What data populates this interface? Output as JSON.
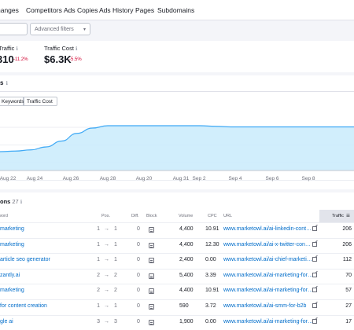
{
  "tabs": [
    "hanges",
    "Competitors",
    "Ads Copies",
    "Ads History",
    "Pages",
    "Subdomains"
  ],
  "filters": {
    "advanced_label": "Advanced filters"
  },
  "metrics": [
    {
      "label": "Traffic",
      "value": "310",
      "delta": "-11.2%"
    },
    {
      "label": "Traffic Cost",
      "value": "$6.3K",
      "delta": "-5.5%"
    }
  ],
  "chart_card": {
    "title": "s",
    "toggle_1": "Keywords",
    "toggle_2": "Traffic Cost"
  },
  "chart_data": {
    "type": "area",
    "x_tick_labels": [
      "Aug 22",
      "Aug 24",
      "Aug 26",
      "Aug 28",
      "Aug 20",
      "Aug 31",
      "Sep 2",
      "Sep 4",
      "Sep 6",
      "Sep 8"
    ],
    "series": [
      {
        "values": [
          0.32,
          0.33,
          0.35,
          0.4,
          0.5,
          0.63,
          0.72,
          0.76,
          0.76,
          0.76,
          0.76,
          0.76,
          0.76,
          0.76,
          0.75,
          0.74,
          0.74,
          0.74,
          0.74,
          0.74,
          0.74,
          0.74,
          0.74,
          0.74
        ]
      }
    ],
    "ylim": [
      0,
      1
    ],
    "grid": true,
    "colors": {
      "line": "#3fa9f5",
      "fill": "#c9ebfb"
    }
  },
  "table": {
    "title": "ons",
    "count": "27",
    "headers": {
      "keyword": "word",
      "pos": "Pos.",
      "diff": "Diff.",
      "block": "Block",
      "volume": "Volume",
      "cpc": "CPC",
      "url": "URL",
      "traffic": "Traffic"
    },
    "rows": [
      {
        "keyword": "marketing",
        "pos_from": "1",
        "pos_to": "1",
        "diff": "0",
        "volume": "4,400",
        "cpc": "10.91",
        "url": "www.marketowl.ai/ai-linkedin-cont…",
        "traffic": "206"
      },
      {
        "keyword": "marketing",
        "pos_from": "1",
        "pos_to": "1",
        "diff": "0",
        "volume": "4,400",
        "cpc": "12.30",
        "url": "www.marketowl.ai/ai-x-twitter-con…",
        "traffic": "206"
      },
      {
        "keyword": "article seo generator",
        "pos_from": "1",
        "pos_to": "1",
        "diff": "0",
        "volume": "2,400",
        "cpc": "0.00",
        "url": "www.marketowl.ai/ai-chief-marketi…",
        "traffic": "112"
      },
      {
        "keyword": "zantly.ai",
        "pos_from": "2",
        "pos_to": "2",
        "diff": "0",
        "volume": "5,400",
        "cpc": "3.39",
        "url": "www.marketowl.ai/ai-marketing-for…",
        "traffic": "70"
      },
      {
        "keyword": "marketing",
        "pos_from": "2",
        "pos_to": "2",
        "diff": "0",
        "volume": "4,400",
        "cpc": "10.91",
        "url": "www.marketowl.ai/ai-marketing-for…",
        "traffic": "57"
      },
      {
        "keyword": "for content creation",
        "pos_from": "1",
        "pos_to": "1",
        "diff": "0",
        "volume": "590",
        "cpc": "3.72",
        "url": "www.marketowl.ai/ai-smm-for-b2b",
        "traffic": "27"
      },
      {
        "keyword": "gle ai",
        "pos_from": "3",
        "pos_to": "3",
        "diff": "0",
        "volume": "1,900",
        "cpc": "0.00",
        "url": "www.marketowl.ai/ai-marketing-for…",
        "traffic": "17"
      }
    ]
  }
}
